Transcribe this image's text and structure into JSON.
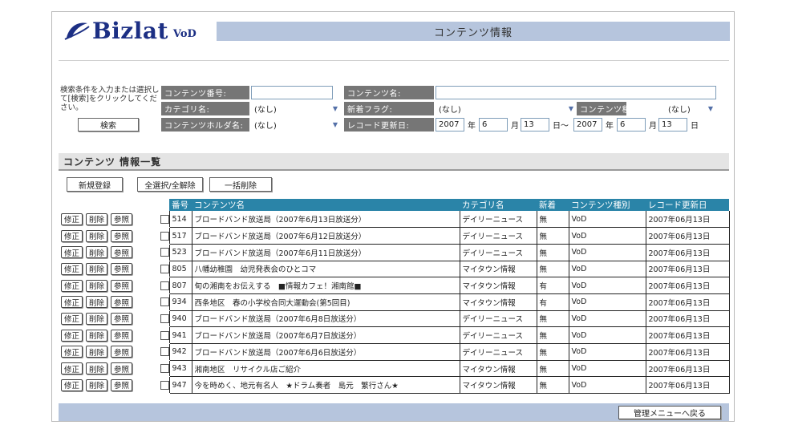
{
  "brand": {
    "name": "Bizlat",
    "sub": "VoD"
  },
  "page_title": "コンテンツ情報",
  "search": {
    "message": "検索条件を入力または選択して[検索]をクリックしてください。",
    "search_button": "検索",
    "labels": {
      "content_no": "コンテンツ番号:",
      "content_name": "コンテンツ名:",
      "category": "カテゴリ名:",
      "new_flag": "新着フラグ:",
      "content_type": "コンテンツ種別:",
      "holder": "コンテンツホルダ名:",
      "updated": "レコード更新日:"
    },
    "values": {
      "content_no": "",
      "content_name": "",
      "category": "(なし)",
      "new_flag": "(なし)",
      "content_type": "(なし)",
      "holder": "(なし)",
      "from_year": "2007",
      "from_month": "6",
      "from_day": "13",
      "to_year": "2007",
      "to_month": "6",
      "to_day": "13"
    },
    "units": {
      "year": "年",
      "month": "月",
      "day": "日",
      "range_day": "日～"
    }
  },
  "list": {
    "heading": "コンテンツ 情報一覧",
    "buttons": {
      "new": "新規登録",
      "select_all": "全選択/全解除",
      "bulk_delete": "一括削除"
    },
    "columns": [
      "番号",
      "コンテンツ名",
      "カテゴリ名",
      "新着",
      "コンテンツ種別",
      "レコード更新日"
    ],
    "row_buttons": {
      "edit": "修正",
      "delete": "削除",
      "view": "参照"
    },
    "rows": [
      {
        "no": "514",
        "name": "ブロードバンド放送局（2007年6月13日放送分）",
        "category": "デイリーニュース",
        "new": "無",
        "type": "VoD",
        "updated": "2007年06月13日"
      },
      {
        "no": "517",
        "name": "ブロードバンド放送局（2007年6月12日放送分）",
        "category": "デイリーニュース",
        "new": "無",
        "type": "VoD",
        "updated": "2007年06月13日"
      },
      {
        "no": "523",
        "name": "ブロードバンド放送局（2007年6月11日放送分）",
        "category": "デイリーニュース",
        "new": "無",
        "type": "VoD",
        "updated": "2007年06月13日"
      },
      {
        "no": "805",
        "name": "八幡幼稚園　幼児発表会のひとコマ",
        "category": "マイタウン情報",
        "new": "無",
        "type": "VoD",
        "updated": "2007年06月13日"
      },
      {
        "no": "807",
        "name": "旬の湘南をお伝えする　■情報カフェ！湘南館■",
        "category": "マイタウン情報",
        "new": "有",
        "type": "VoD",
        "updated": "2007年06月13日"
      },
      {
        "no": "934",
        "name": "西条地区　春の小学校合同大運動会(第5回目)",
        "category": "マイタウン情報",
        "new": "有",
        "type": "VoD",
        "updated": "2007年06月13日"
      },
      {
        "no": "940",
        "name": "ブロードバンド放送局（2007年6月8日放送分）",
        "category": "デイリーニュース",
        "new": "無",
        "type": "VoD",
        "updated": "2007年06月13日"
      },
      {
        "no": "941",
        "name": "ブロードバンド放送局（2007年6月7日放送分）",
        "category": "デイリーニュース",
        "new": "無",
        "type": "VoD",
        "updated": "2007年06月13日"
      },
      {
        "no": "942",
        "name": "ブロードバンド放送局（2007年6月6日放送分）",
        "category": "デイリーニュース",
        "new": "無",
        "type": "VoD",
        "updated": "2007年06月13日"
      },
      {
        "no": "943",
        "name": "湘南地区　リサイクル店ご紹介",
        "category": "マイタウン情報",
        "new": "無",
        "type": "VoD",
        "updated": "2007年06月13日"
      },
      {
        "no": "947",
        "name": "今を時めく、地元有名人　★ドラム奏者　島元　繁行さん★",
        "category": "マイタウン情報",
        "new": "無",
        "type": "VoD",
        "updated": "2007年06月13日"
      }
    ]
  },
  "footer": {
    "back_button": "管理メニューへ戻る"
  },
  "colors": {
    "brand": "#1c2f84",
    "title_bar": "#b6c5dd",
    "table_header": "#2a84a8",
    "label_bg": "#767676"
  }
}
